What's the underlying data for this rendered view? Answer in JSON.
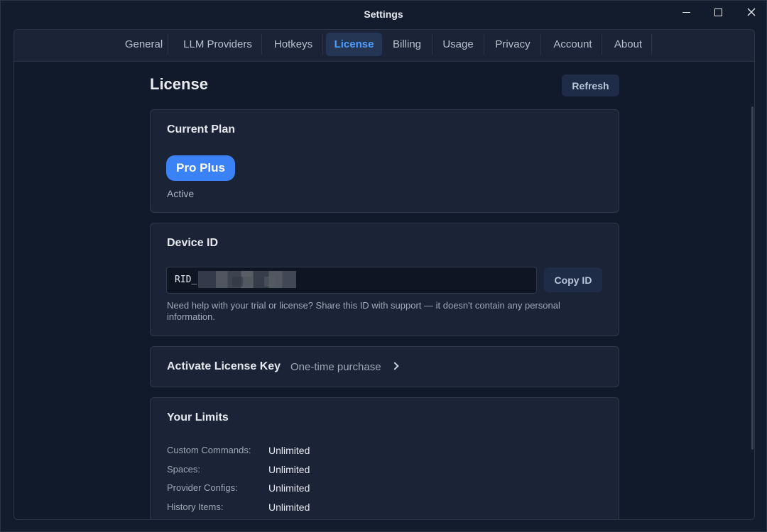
{
  "window": {
    "title": "Settings"
  },
  "tabs": [
    {
      "label": "General"
    },
    {
      "label": "LLM Providers"
    },
    {
      "label": "Hotkeys"
    },
    {
      "label": "License"
    },
    {
      "label": "Billing"
    },
    {
      "label": "Usage"
    },
    {
      "label": "Privacy"
    },
    {
      "label": "Account"
    },
    {
      "label": "About"
    }
  ],
  "active_tab": "License",
  "page": {
    "title": "License",
    "refresh_label": "Refresh"
  },
  "current_plan": {
    "title": "Current Plan",
    "plan_name": "Pro Plus",
    "status": "Active"
  },
  "device": {
    "title": "Device ID",
    "id_prefix": "RID_",
    "copy_label": "Copy ID",
    "help": "Need help with your trial or license? Share this ID with support — it doesn't contain any personal information."
  },
  "activate": {
    "title": "Activate License Key",
    "subtitle": "One-time purchase"
  },
  "limits": {
    "title": "Your Limits",
    "items": [
      {
        "label": "Custom Commands:",
        "value": "Unlimited"
      },
      {
        "label": "Spaces:",
        "value": "Unlimited"
      },
      {
        "label": "Provider Configs:",
        "value": "Unlimited"
      },
      {
        "label": "History Items:",
        "value": "Unlimited"
      }
    ]
  },
  "colors": {
    "accent": "#3b82f6",
    "active_tab_text": "#4e9dff",
    "background": "#111a2a",
    "card": "#1b2436"
  }
}
